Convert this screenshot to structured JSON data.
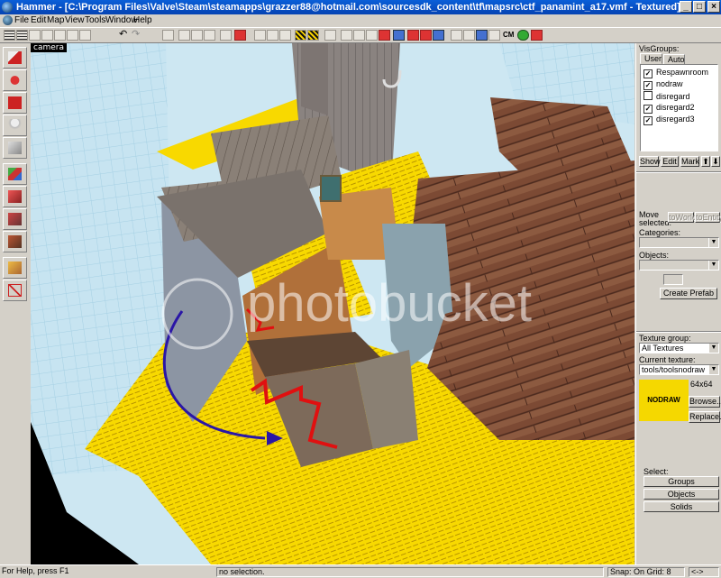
{
  "window": {
    "title": "Hammer - [C:\\Program Files\\Valve\\Steam\\steamapps\\grazzer88@hotmail.com\\sourcesdk_content\\tf\\mapsrc\\ctf_panamint_a17.vmf - Textured]",
    "minimize": "_",
    "maximize": "□",
    "close": "×"
  },
  "menu": [
    "File",
    "Edit",
    "Map",
    "View",
    "Tools",
    "Window",
    "Help"
  ],
  "toolbar": {
    "snap_label": "CM"
  },
  "left_tools": [
    "selection-tool",
    "magnify-tool",
    "camera-tool",
    "entity-tool",
    "block-tool",
    "texture-tool",
    "apply-texture-tool",
    "decal-tool",
    "overlay-tool",
    "clipping-tool",
    "vertex-tool"
  ],
  "viewport": {
    "label": "camera",
    "watermark": "photobucket"
  },
  "right_panel": {
    "visgroups_label": "VisGroups:",
    "tabs": [
      "User",
      "Auto"
    ],
    "visgroups": [
      {
        "name": "Respawnroom",
        "checked": true
      },
      {
        "name": "nodraw",
        "checked": true
      },
      {
        "name": "disregard",
        "checked": false
      },
      {
        "name": "disregard2",
        "checked": true
      },
      {
        "name": "disregard3",
        "checked": true
      }
    ],
    "vis_buttons": [
      "Show",
      "Edit",
      "Mark",
      "⬆",
      "⬇"
    ],
    "move_selected_label": "Move selected:",
    "to_world": "toWorld",
    "to_entity": "toEntity",
    "categories_label": "Categories:",
    "objects_label": "Objects:",
    "create_prefab": "Create Prefab",
    "texture_group_label": "Texture group:",
    "texture_group_value": "All Textures",
    "current_texture_label": "Current texture:",
    "current_texture_value": "tools/toolsnodraw",
    "texture_size": "64x64",
    "texture_preview_text": "NODRAW",
    "browse": "Browse...",
    "replace": "Replace...",
    "select_label": "Select:",
    "select_buttons": [
      "Groups",
      "Objects",
      "Solids"
    ]
  },
  "status": {
    "help": "For Help, press F1",
    "selection": "no selection.",
    "snap": "Snap: On Grid: 8",
    "arrows": "<->"
  }
}
